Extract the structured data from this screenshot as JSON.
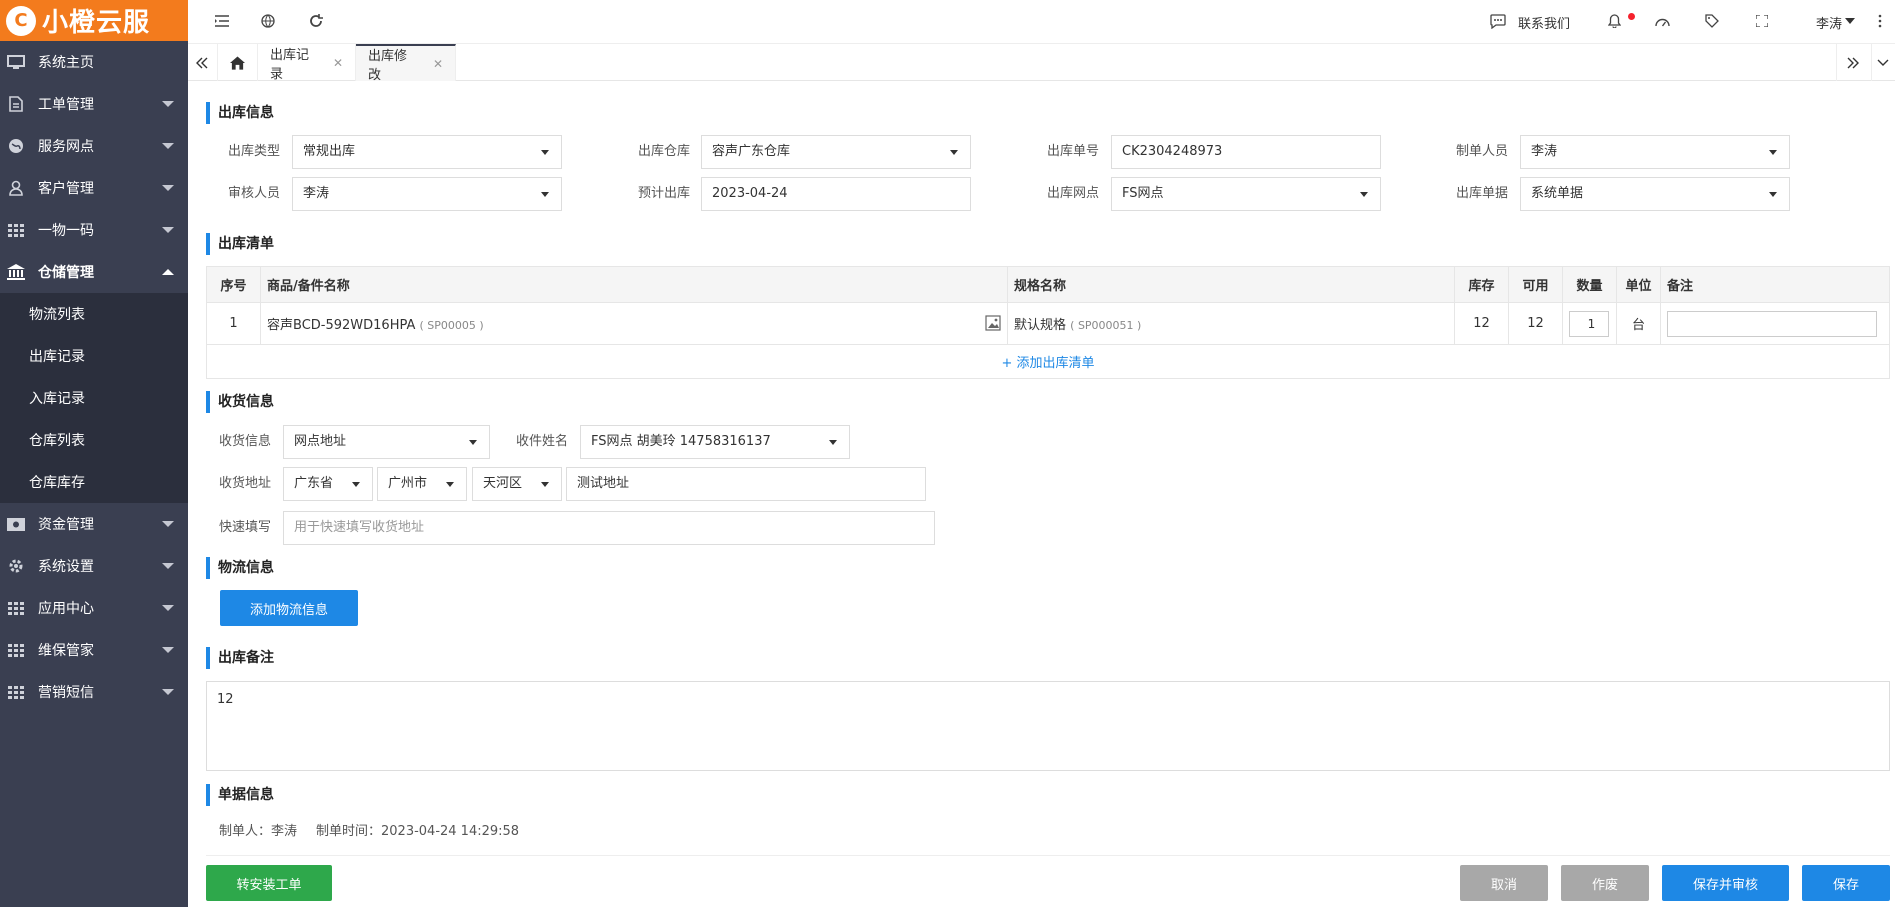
{
  "brand": {
    "logo_text": "小橙云服",
    "logo_mark": "C"
  },
  "sidebar": {
    "items": [
      {
        "label": "系统主页",
        "icon": "monitor-icon",
        "has_arrow": false
      },
      {
        "label": "工单管理",
        "icon": "document-icon",
        "has_arrow": true
      },
      {
        "label": "服务网点",
        "icon": "globe-icon",
        "has_arrow": true
      },
      {
        "label": "客户管理",
        "icon": "user-icon",
        "has_arrow": true
      },
      {
        "label": "一物一码",
        "icon": "grid-icon",
        "has_arrow": true
      },
      {
        "label": "仓储管理",
        "icon": "bank-icon",
        "has_arrow": true,
        "open": true
      }
    ],
    "submenu": [
      "物流列表",
      "出库记录",
      "入库记录",
      "仓库列表",
      "仓库库存"
    ],
    "items_after": [
      {
        "label": "资金管理",
        "icon": "money-icon"
      },
      {
        "label": "系统设置",
        "icon": "gear-icon"
      },
      {
        "label": "应用中心",
        "icon": "grid-icon"
      },
      {
        "label": "维保管家",
        "icon": "grid-icon"
      },
      {
        "label": "营销短信",
        "icon": "grid-icon"
      }
    ]
  },
  "topbar": {
    "contact_label": "联系我们",
    "user_name": "李涛"
  },
  "tabs": {
    "home_icon": "home-icon",
    "items": [
      {
        "label": "出库记录",
        "active": false
      },
      {
        "label": "出库修改",
        "active": true
      }
    ]
  },
  "outbound_info": {
    "title": "出库信息",
    "type_label": "出库类型",
    "type_value": "常规出库",
    "warehouse_label": "出库仓库",
    "warehouse_value": "容声广东仓库",
    "order_no_label": "出库单号",
    "order_no_value": "CK2304248973",
    "creator_label": "制单人员",
    "creator_value": "李涛",
    "reviewer_label": "审核人员",
    "reviewer_value": "李涛",
    "planned_label": "预计出库",
    "planned_value": "2023-04-24",
    "site_label": "出库网点",
    "site_value": "FS网点",
    "doc_label": "出库单据",
    "doc_value": "系统单据"
  },
  "outbound_list": {
    "title": "出库清单",
    "headers": [
      "序号",
      "商品/备件名称",
      "规格名称",
      "库存",
      "可用",
      "数量",
      "单位",
      "备注"
    ],
    "rows": [
      {
        "no": "1",
        "name": "容声BCD-592WD16HPA",
        "code": "( SP00005 )",
        "spec": "默认规格",
        "spec_code": "( SP000051 )",
        "stock": "12",
        "available": "12",
        "qty": "1",
        "unit": "台",
        "note": ""
      }
    ],
    "add_label": "+ 添加出库清单"
  },
  "receive_info": {
    "title": "收货信息",
    "info_label": "收货信息",
    "info_value": "网点地址",
    "name_label": "收件姓名",
    "name_value": "FS网点 胡美玲 14758316137",
    "addr_label": "收货地址",
    "province": "广东省",
    "city": "广州市",
    "district": "天河区",
    "detail": "测试地址",
    "quick_label": "快速填写",
    "quick_placeholder": "用于快速填写收货地址"
  },
  "logistics": {
    "title": "物流信息",
    "add_button": "添加物流信息"
  },
  "remarks": {
    "title": "出库备注",
    "value": "12"
  },
  "doc_info": {
    "title": "单据信息",
    "creator_text": "制单人：李涛",
    "time_text": "制单时间：2023-04-24 14:29:58"
  },
  "actions": {
    "convert": "转安装工单",
    "cancel": "取消",
    "void": "作废",
    "save_review": "保存并审核",
    "save": "保存"
  }
}
